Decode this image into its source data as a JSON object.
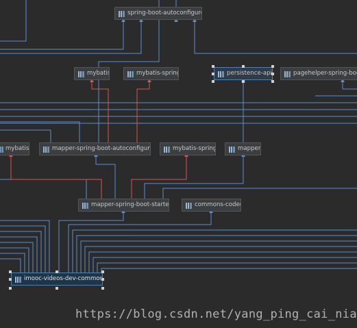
{
  "diagram": {
    "nodes": {
      "spring_boot_autoconfigure": "spring-boot-autoconfigure",
      "mybatis_top": "mybatis",
      "mybatis_spring_top": "mybatis-spring",
      "persistence_api": "persistence-api",
      "pagehelper_spring_boot": "pagehelper-spring-boot",
      "mybatis_mid": "mybatis",
      "mapper_spring_boot_autoconfigure": "mapper-spring-boot-autoconfigure",
      "mybatis_spring_mid": "mybatis-spring",
      "mapper": "mapper",
      "mapper_spring_boot_starter": "mapper-spring-boot-starter",
      "commons_codec": "commons-codec",
      "imooc_videos_dev_common": "imooc-videos-dev-common"
    },
    "colors": {
      "background": "#2b2b2b",
      "dependency_edge": "#5b8fd6",
      "conflict_edge": "#d9534f",
      "node_fill": "#3c3f41",
      "selected_border": "#4f81b3"
    },
    "icon": "module-library-icon"
  },
  "watermark": "https://blog.csdn.net/yang_ping_cai_niao"
}
